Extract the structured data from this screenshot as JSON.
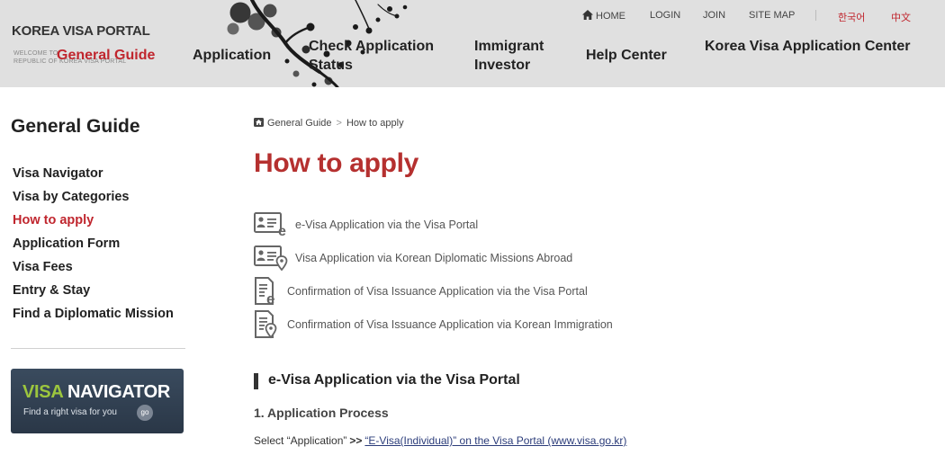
{
  "header": {
    "logo_title": "KOREA VISA PORTAL",
    "logo_sub_1": "WELCOME TO",
    "logo_sub_2": "REPUBLIC OF KOREA VISA PORTAL",
    "nav": {
      "general_guide": "General Guide",
      "application": "Application",
      "check_line1": "Check Application",
      "check_line2": "Status",
      "immigrant_line1": "Immigrant",
      "immigrant_line2": "Investor",
      "help_center": "Help Center",
      "application_center": "Korea Visa Application Center"
    },
    "util": {
      "home": "HOME",
      "login": "LOGIN",
      "join": "JOIN",
      "site_map": "SITE MAP",
      "korean": "한국어",
      "chinese": "中文"
    }
  },
  "sidebar": {
    "title": "General Guide",
    "items": [
      {
        "label": "Visa Navigator"
      },
      {
        "label": "Visa by Categories"
      },
      {
        "label": "How to apply"
      },
      {
        "label": "Application Form"
      },
      {
        "label": "Visa Fees"
      },
      {
        "label": "Entry & Stay"
      },
      {
        "label": "Find a Diplomatic Mission"
      }
    ],
    "active_index": 2,
    "banner": {
      "title_green": "VISA",
      "title_white": "NAVIGATOR",
      "subtitle": "Find a right visa for you",
      "go": "go"
    }
  },
  "breadcrumb": {
    "level1": "General Guide",
    "separator": ">",
    "level2": "How to apply"
  },
  "main": {
    "title": "How to apply",
    "options": [
      {
        "icon": "id-card-e-icon",
        "label": "e-Visa Application via the Visa Portal"
      },
      {
        "icon": "id-card-location-icon",
        "label": "Visa Application via Korean Diplomatic Missions Abroad"
      },
      {
        "icon": "document-e-icon",
        "label": "Confirmation of Visa Issuance Application via the Visa Portal"
      },
      {
        "icon": "document-location-icon",
        "label": "Confirmation of Visa Issuance Application via Korean Immigration"
      }
    ],
    "section_title": "e-Visa Application via the Visa Portal",
    "subsection_title": "1. Application Process",
    "process": {
      "prefix": "Select “Application”",
      "arrow": ">>",
      "link": "“E-Visa(Individual)” on the Visa Portal (www.visa.go.kr)"
    }
  },
  "colors": {
    "accent_red": "#c0262e",
    "title_red": "#b5302f",
    "header_bg": "#e0e0e0",
    "banner_green": "#9cc63e",
    "banner_bg": "#2f3d4e",
    "link_blue": "#2b3c7a"
  }
}
